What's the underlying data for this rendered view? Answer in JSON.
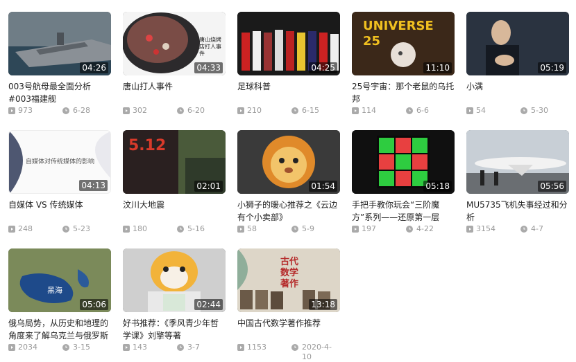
{
  "videos": [
    {
      "title": "003号航母最全面分析#003福建舰",
      "duration": "04:26",
      "views": "973",
      "date": "6-28"
    },
    {
      "title": "唐山打人事件",
      "duration": "04:33",
      "views": "302",
      "date": "6-20",
      "thumb_text": "唐山烧烤店打人事件"
    },
    {
      "title": "足球科普",
      "duration": "04:25",
      "views": "210",
      "date": "6-15"
    },
    {
      "title": "25号宇宙：那个老鼠的乌托邦",
      "duration": "11:10",
      "views": "114",
      "date": "6-6",
      "thumb_text": "UNIVERSE 25"
    },
    {
      "title": "小满",
      "duration": "05:19",
      "views": "54",
      "date": "5-30"
    },
    {
      "title": "自媒体 VS 传统媒体",
      "duration": "04:13",
      "views": "248",
      "date": "5-23",
      "thumb_text": "自媒体对传统媒体的影响"
    },
    {
      "title": "汶川大地震",
      "duration": "02:01",
      "views": "180",
      "date": "5-16",
      "thumb_text": "5.12"
    },
    {
      "title": "小狮子的暖心推荐之《云边有个小卖部》",
      "duration": "01:54",
      "views": "58",
      "date": "5-9"
    },
    {
      "title": "手把手教你玩会“三阶魔方”系列——还原第一层",
      "duration": "05:18",
      "views": "197",
      "date": "4-22"
    },
    {
      "title": "MU5735飞机失事经过和分析",
      "duration": "05:56",
      "views": "3154",
      "date": "4-7"
    },
    {
      "title": "俄乌局势，从历史和地理的角度来了解乌克兰与俄罗斯的这",
      "duration": "05:06",
      "views": "2034",
      "date": "3-15",
      "thumb_text": "黑海"
    },
    {
      "title": "好书推荐：《季风青少年哲学课》刘擎等著",
      "duration": "02:44",
      "views": "143",
      "date": "3-7"
    },
    {
      "title": "中国古代数学著作推荐",
      "duration": "13:18",
      "views": "1153",
      "date": "2020-4-10",
      "thumb_text": "古代数学著作"
    }
  ]
}
